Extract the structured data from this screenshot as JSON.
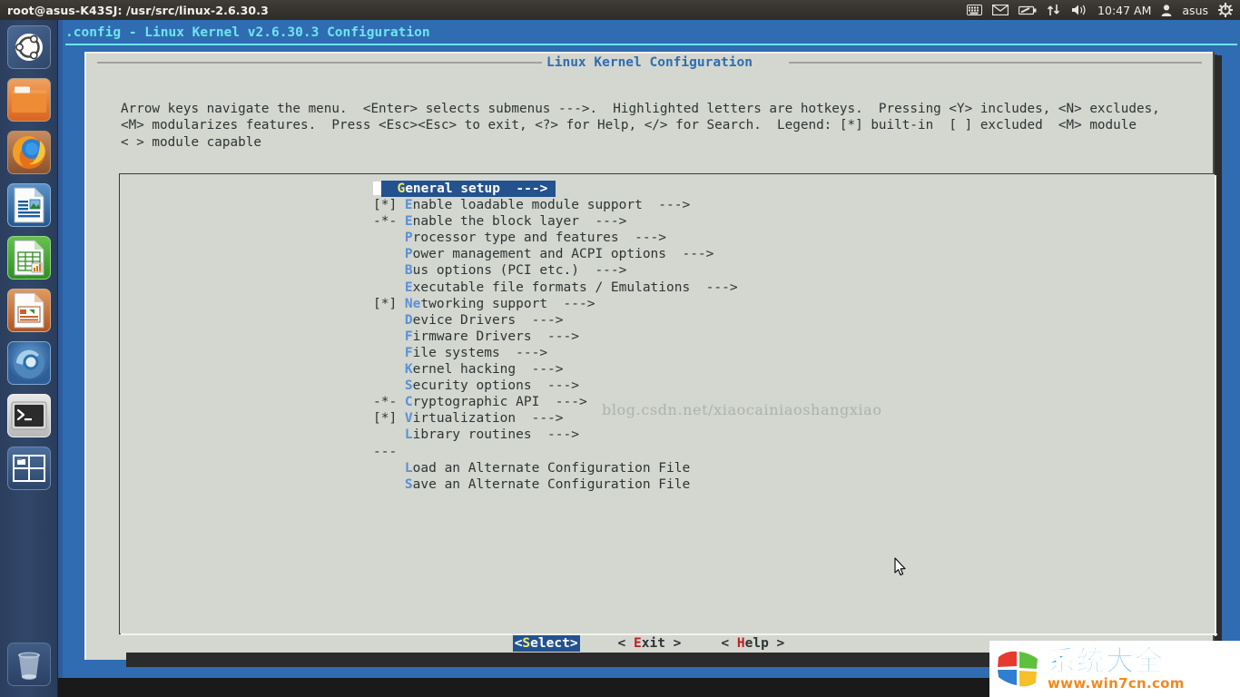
{
  "top_panel": {
    "window_title": "root@asus-K43SJ: /usr/src/linux-2.6.30.3",
    "tray": {
      "keyboard_icon": "keyboard-icon",
      "mail_icon": "envelope-icon",
      "battery_icon": "battery-icon",
      "network_icon": "network-updown-icon",
      "volume_icon": "volume-icon",
      "clock": "10:47 AM",
      "user_icon": "user-icon",
      "user_name": "asus",
      "session_icon": "gear-power-icon"
    }
  },
  "launcher": {
    "items": [
      {
        "name": "ubuntu-dash",
        "label": "Ubuntu Dash Home",
        "icon": "ubuntu-logo-icon",
        "active": false
      },
      {
        "name": "files",
        "label": "Files",
        "icon": "folder-icon",
        "active": false
      },
      {
        "name": "firefox",
        "label": "Firefox Web Browser",
        "icon": "firefox-icon",
        "active": false
      },
      {
        "name": "writer",
        "label": "LibreOffice Writer",
        "icon": "document-icon",
        "active": false
      },
      {
        "name": "calc",
        "label": "LibreOffice Calc",
        "icon": "spreadsheet-icon",
        "active": false
      },
      {
        "name": "impress",
        "label": "LibreOffice Impress",
        "icon": "presentation-icon",
        "active": false
      },
      {
        "name": "software-center",
        "label": "Ubuntu Software Center",
        "icon": "software-center-icon",
        "active": false
      },
      {
        "name": "terminal",
        "label": "Terminal",
        "icon": "terminal-icon",
        "active": true
      },
      {
        "name": "workspace-switcher",
        "label": "Workspace Switcher",
        "icon": "workspace-icon",
        "active": false
      }
    ],
    "trash": {
      "name": "trash",
      "label": "Trash",
      "icon": "trash-icon"
    }
  },
  "menuconfig": {
    "backtitle": ".config - Linux Kernel v2.6.30.3 Configuration",
    "dialog_title": "Linux Kernel Configuration",
    "help_lines": [
      "Arrow keys navigate the menu.  <Enter> selects submenus --->.  Highlighted letters are hotkeys.  Pressing <Y> includes, <N> excludes,",
      "<M> modularizes features.  Press <Esc><Esc> to exit, <?> for Help, </> for Search.  Legend: [*] built-in  [ ] excluded  <M> module",
      "< > module capable"
    ],
    "items": [
      {
        "prefix": "   ",
        "hotkey": "G",
        "rest": "eneral setup",
        "arrow": "  --->",
        "selected": true,
        "separator": false
      },
      {
        "prefix": "[*]",
        "hotkey": "E",
        "rest": "nable loadable module support",
        "arrow": "  --->",
        "selected": false,
        "separator": false
      },
      {
        "prefix": "-*-",
        "hotkey": "E",
        "rest": "nable the block layer",
        "arrow": "  --->",
        "selected": false,
        "separator": false
      },
      {
        "prefix": "   ",
        "hotkey": "P",
        "rest": "rocessor type and features",
        "arrow": "  --->",
        "selected": false,
        "separator": false
      },
      {
        "prefix": "   ",
        "hotkey": "P",
        "rest": "ower management and ACPI options",
        "arrow": "  --->",
        "selected": false,
        "separator": false
      },
      {
        "prefix": "   ",
        "hotkey": "B",
        "rest": "us options (PCI etc.)",
        "arrow": "  --->",
        "selected": false,
        "separator": false
      },
      {
        "prefix": "   ",
        "hotkey": "E",
        "rest": "xecutable file formats / Emulations",
        "arrow": "  --->",
        "selected": false,
        "separator": false
      },
      {
        "prefix": "[*]",
        "hotkey": "Ne",
        "rest": "tworking support",
        "arrow": "  --->",
        "selected": false,
        "separator": false
      },
      {
        "prefix": "   ",
        "hotkey": "D",
        "rest": "evice Drivers",
        "arrow": "  --->",
        "selected": false,
        "separator": false
      },
      {
        "prefix": "   ",
        "hotkey": "F",
        "rest": "irmware Drivers",
        "arrow": "  --->",
        "selected": false,
        "separator": false
      },
      {
        "prefix": "   ",
        "hotkey": "F",
        "rest": "ile systems",
        "arrow": "  --->",
        "selected": false,
        "separator": false
      },
      {
        "prefix": "   ",
        "hotkey": "K",
        "rest": "ernel hacking",
        "arrow": "  --->",
        "selected": false,
        "separator": false
      },
      {
        "prefix": "   ",
        "hotkey": "S",
        "rest": "ecurity options",
        "arrow": "  --->",
        "selected": false,
        "separator": false
      },
      {
        "prefix": "-*-",
        "hotkey": "C",
        "rest": "ryptographic API",
        "arrow": "  --->",
        "selected": false,
        "separator": false
      },
      {
        "prefix": "[*]",
        "hotkey": "V",
        "rest": "irtualization",
        "arrow": "  --->",
        "selected": false,
        "separator": false
      },
      {
        "prefix": "   ",
        "hotkey": "L",
        "rest": "ibrary routines",
        "arrow": "  --->",
        "selected": false,
        "separator": false
      },
      {
        "prefix": "---",
        "hotkey": "",
        "rest": "",
        "arrow": "",
        "selected": false,
        "separator": true
      },
      {
        "prefix": "   ",
        "hotkey": "L",
        "rest": "oad an Alternate Configuration File",
        "arrow": "",
        "selected": false,
        "separator": false
      },
      {
        "prefix": "   ",
        "hotkey": "S",
        "rest": "ave an Alternate Configuration File",
        "arrow": "",
        "selected": false,
        "separator": false
      }
    ],
    "buttons": [
      {
        "name": "select-button",
        "open": "<",
        "hotkey": "S",
        "rest": "elect",
        "close": ">",
        "selected": true
      },
      {
        "name": "exit-button",
        "open": "< ",
        "hotkey": "E",
        "rest": "xit",
        "close": " >",
        "selected": false
      },
      {
        "name": "help-button",
        "open": "< ",
        "hotkey": "H",
        "rest": "elp",
        "close": " >",
        "selected": false
      }
    ]
  },
  "watermarks": {
    "csdn": "blog.csdn.net/xiaocainiaoshangxiao",
    "brand_cn": "系统大全",
    "brand_url": "www.win7cn.com"
  },
  "colors": {
    "terminal_blue": "#2f6cb2",
    "dialog_bg": "#d3d7cf",
    "highlight_blue": "#23528f",
    "hotkey_blue": "#5c8fd6",
    "hotkey_red": "#c02020",
    "hotkey_yellow": "#f3e96b",
    "backtitle_cyan": "#6fe4ef"
  }
}
